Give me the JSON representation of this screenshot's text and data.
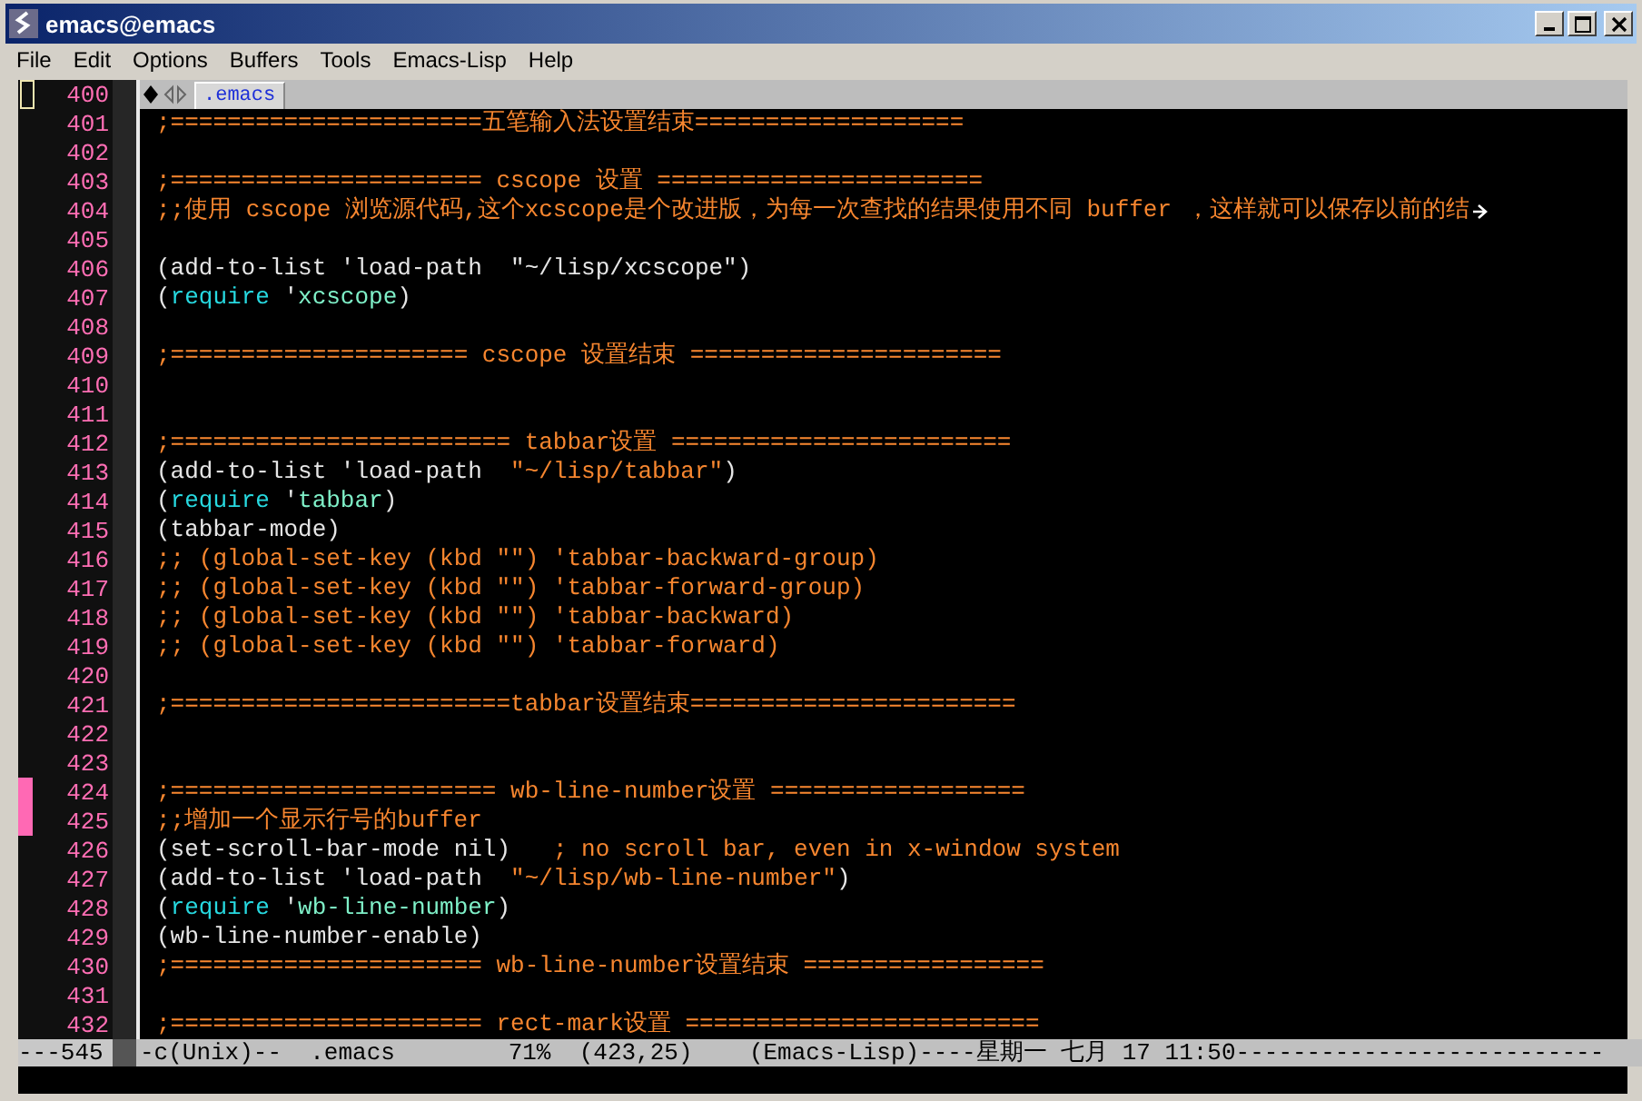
{
  "window": {
    "title": "emacs@emacs"
  },
  "menu": [
    "File",
    "Edit",
    "Options",
    "Buffers",
    "Tools",
    "Emacs-Lisp",
    "Help"
  ],
  "tabs": [
    {
      "label": ".emacs",
      "selected": true
    }
  ],
  "lines": [
    {
      "number": "400",
      "marked": false,
      "cursor": true
    },
    {
      "number": "401",
      "marked": false,
      "cursor": false,
      "segments": [
        {
          "kind": "comment",
          "text": ";======================五笔输入法设置结束==================="
        }
      ]
    },
    {
      "number": "402",
      "marked": false,
      "cursor": false
    },
    {
      "number": "403",
      "marked": false,
      "cursor": false,
      "segments": [
        {
          "kind": "comment",
          "text": ";====================== cscope 设置 ======================="
        }
      ]
    },
    {
      "number": "404",
      "marked": false,
      "cursor": false,
      "wrapped": true,
      "segments": [
        {
          "kind": "comment",
          "text": ";;使用 cscope 浏览源代码,这个xcscope是个改进版，为每一次查找的结果使用不同 buffer ，这样就可以保存以前的结"
        }
      ]
    },
    {
      "number": "405",
      "marked": false,
      "cursor": false
    },
    {
      "number": "406",
      "marked": false,
      "cursor": false,
      "segments": [
        {
          "kind": "plain",
          "text": "(add-to-list 'load-path  \"~/lisp/xcscope\")"
        }
      ]
    },
    {
      "number": "407",
      "marked": false,
      "cursor": false,
      "segments": [
        {
          "kind": "plain",
          "text": "("
        },
        {
          "kind": "keyword",
          "text": "require"
        },
        {
          "kind": "plain",
          "text": " '"
        },
        {
          "kind": "constant",
          "text": "xcscope"
        },
        {
          "kind": "plain",
          "text": ")"
        }
      ]
    },
    {
      "number": "408",
      "marked": false,
      "cursor": false
    },
    {
      "number": "409",
      "marked": false,
      "cursor": false,
      "segments": [
        {
          "kind": "comment",
          "text": ";===================== cscope 设置结束 ======================"
        }
      ]
    },
    {
      "number": "410",
      "marked": false,
      "cursor": false
    },
    {
      "number": "411",
      "marked": false,
      "cursor": false
    },
    {
      "number": "412",
      "marked": false,
      "cursor": false,
      "segments": [
        {
          "kind": "comment",
          "text": ";======================== tabbar设置 ========================"
        }
      ]
    },
    {
      "number": "413",
      "marked": false,
      "cursor": false,
      "segments": [
        {
          "kind": "plain",
          "text": "(add-to-list 'load-path  "
        },
        {
          "kind": "string",
          "text": "\"~/lisp/tabbar\""
        },
        {
          "kind": "plain",
          "text": ")"
        }
      ]
    },
    {
      "number": "414",
      "marked": false,
      "cursor": false,
      "segments": [
        {
          "kind": "plain",
          "text": "("
        },
        {
          "kind": "keyword",
          "text": "require"
        },
        {
          "kind": "plain",
          "text": " '"
        },
        {
          "kind": "constant",
          "text": "tabbar"
        },
        {
          "kind": "plain",
          "text": ")"
        }
      ]
    },
    {
      "number": "415",
      "marked": false,
      "cursor": false,
      "segments": [
        {
          "kind": "plain",
          "text": "(tabbar-mode)"
        }
      ]
    },
    {
      "number": "416",
      "marked": false,
      "cursor": false,
      "segments": [
        {
          "kind": "comment",
          "text": ";; (global-set-key (kbd \"\") 'tabbar-backward-group)"
        }
      ]
    },
    {
      "number": "417",
      "marked": false,
      "cursor": false,
      "segments": [
        {
          "kind": "comment",
          "text": ";; (global-set-key (kbd \"\") 'tabbar-forward-group)"
        }
      ]
    },
    {
      "number": "418",
      "marked": false,
      "cursor": false,
      "segments": [
        {
          "kind": "comment",
          "text": ";; (global-set-key (kbd \"\") 'tabbar-backward)"
        }
      ]
    },
    {
      "number": "419",
      "marked": false,
      "cursor": false,
      "segments": [
        {
          "kind": "comment",
          "text": ";; (global-set-key (kbd \"\") 'tabbar-forward)"
        }
      ]
    },
    {
      "number": "420",
      "marked": false,
      "cursor": false
    },
    {
      "number": "421",
      "marked": false,
      "cursor": false,
      "segments": [
        {
          "kind": "comment",
          "text": ";========================tabbar设置结束======================="
        }
      ]
    },
    {
      "number": "422",
      "marked": false,
      "cursor": false
    },
    {
      "number": "423",
      "marked": false,
      "cursor": false
    },
    {
      "number": "424",
      "marked": true,
      "cursor": false,
      "segments": [
        {
          "kind": "comment",
          "text": ";======================= wb-line-number设置 =================="
        }
      ]
    },
    {
      "number": "425",
      "marked": true,
      "cursor": false,
      "segments": [
        {
          "kind": "comment",
          "text": ";;增加一个显示行号的buffer"
        }
      ]
    },
    {
      "number": "426",
      "marked": false,
      "cursor": false,
      "segments": [
        {
          "kind": "plain",
          "text": "(set-scroll-bar-mode nil)   "
        },
        {
          "kind": "comment",
          "text": "; no scroll bar, even in x-window system"
        }
      ]
    },
    {
      "number": "427",
      "marked": false,
      "cursor": false,
      "segments": [
        {
          "kind": "plain",
          "text": "(add-to-list 'load-path  "
        },
        {
          "kind": "string",
          "text": "\"~/lisp/wb-line-number\""
        },
        {
          "kind": "plain",
          "text": ")"
        }
      ]
    },
    {
      "number": "428",
      "marked": false,
      "cursor": false,
      "segments": [
        {
          "kind": "plain",
          "text": "("
        },
        {
          "kind": "keyword",
          "text": "require"
        },
        {
          "kind": "plain",
          "text": " '"
        },
        {
          "kind": "constant",
          "text": "wb-line-number"
        },
        {
          "kind": "plain",
          "text": ")"
        }
      ]
    },
    {
      "number": "429",
      "marked": false,
      "cursor": false,
      "segments": [
        {
          "kind": "plain",
          "text": "(wb-line-number-enable)"
        }
      ]
    },
    {
      "number": "430",
      "marked": false,
      "cursor": false,
      "segments": [
        {
          "kind": "comment",
          "text": ";====================== wb-line-number设置结束 ================="
        }
      ]
    },
    {
      "number": "431",
      "marked": false,
      "cursor": false
    },
    {
      "number": "432",
      "marked": false,
      "cursor": false,
      "segments": [
        {
          "kind": "comment",
          "text": ";====================== rect-mark设置 ========================="
        }
      ]
    }
  ],
  "mode_line": {
    "left": "---545",
    "text": "-c(Unix)--  .emacs        71%  (423,25)    (Emacs-Lisp)----星期一 七月 17 11:50--------------------------"
  }
}
